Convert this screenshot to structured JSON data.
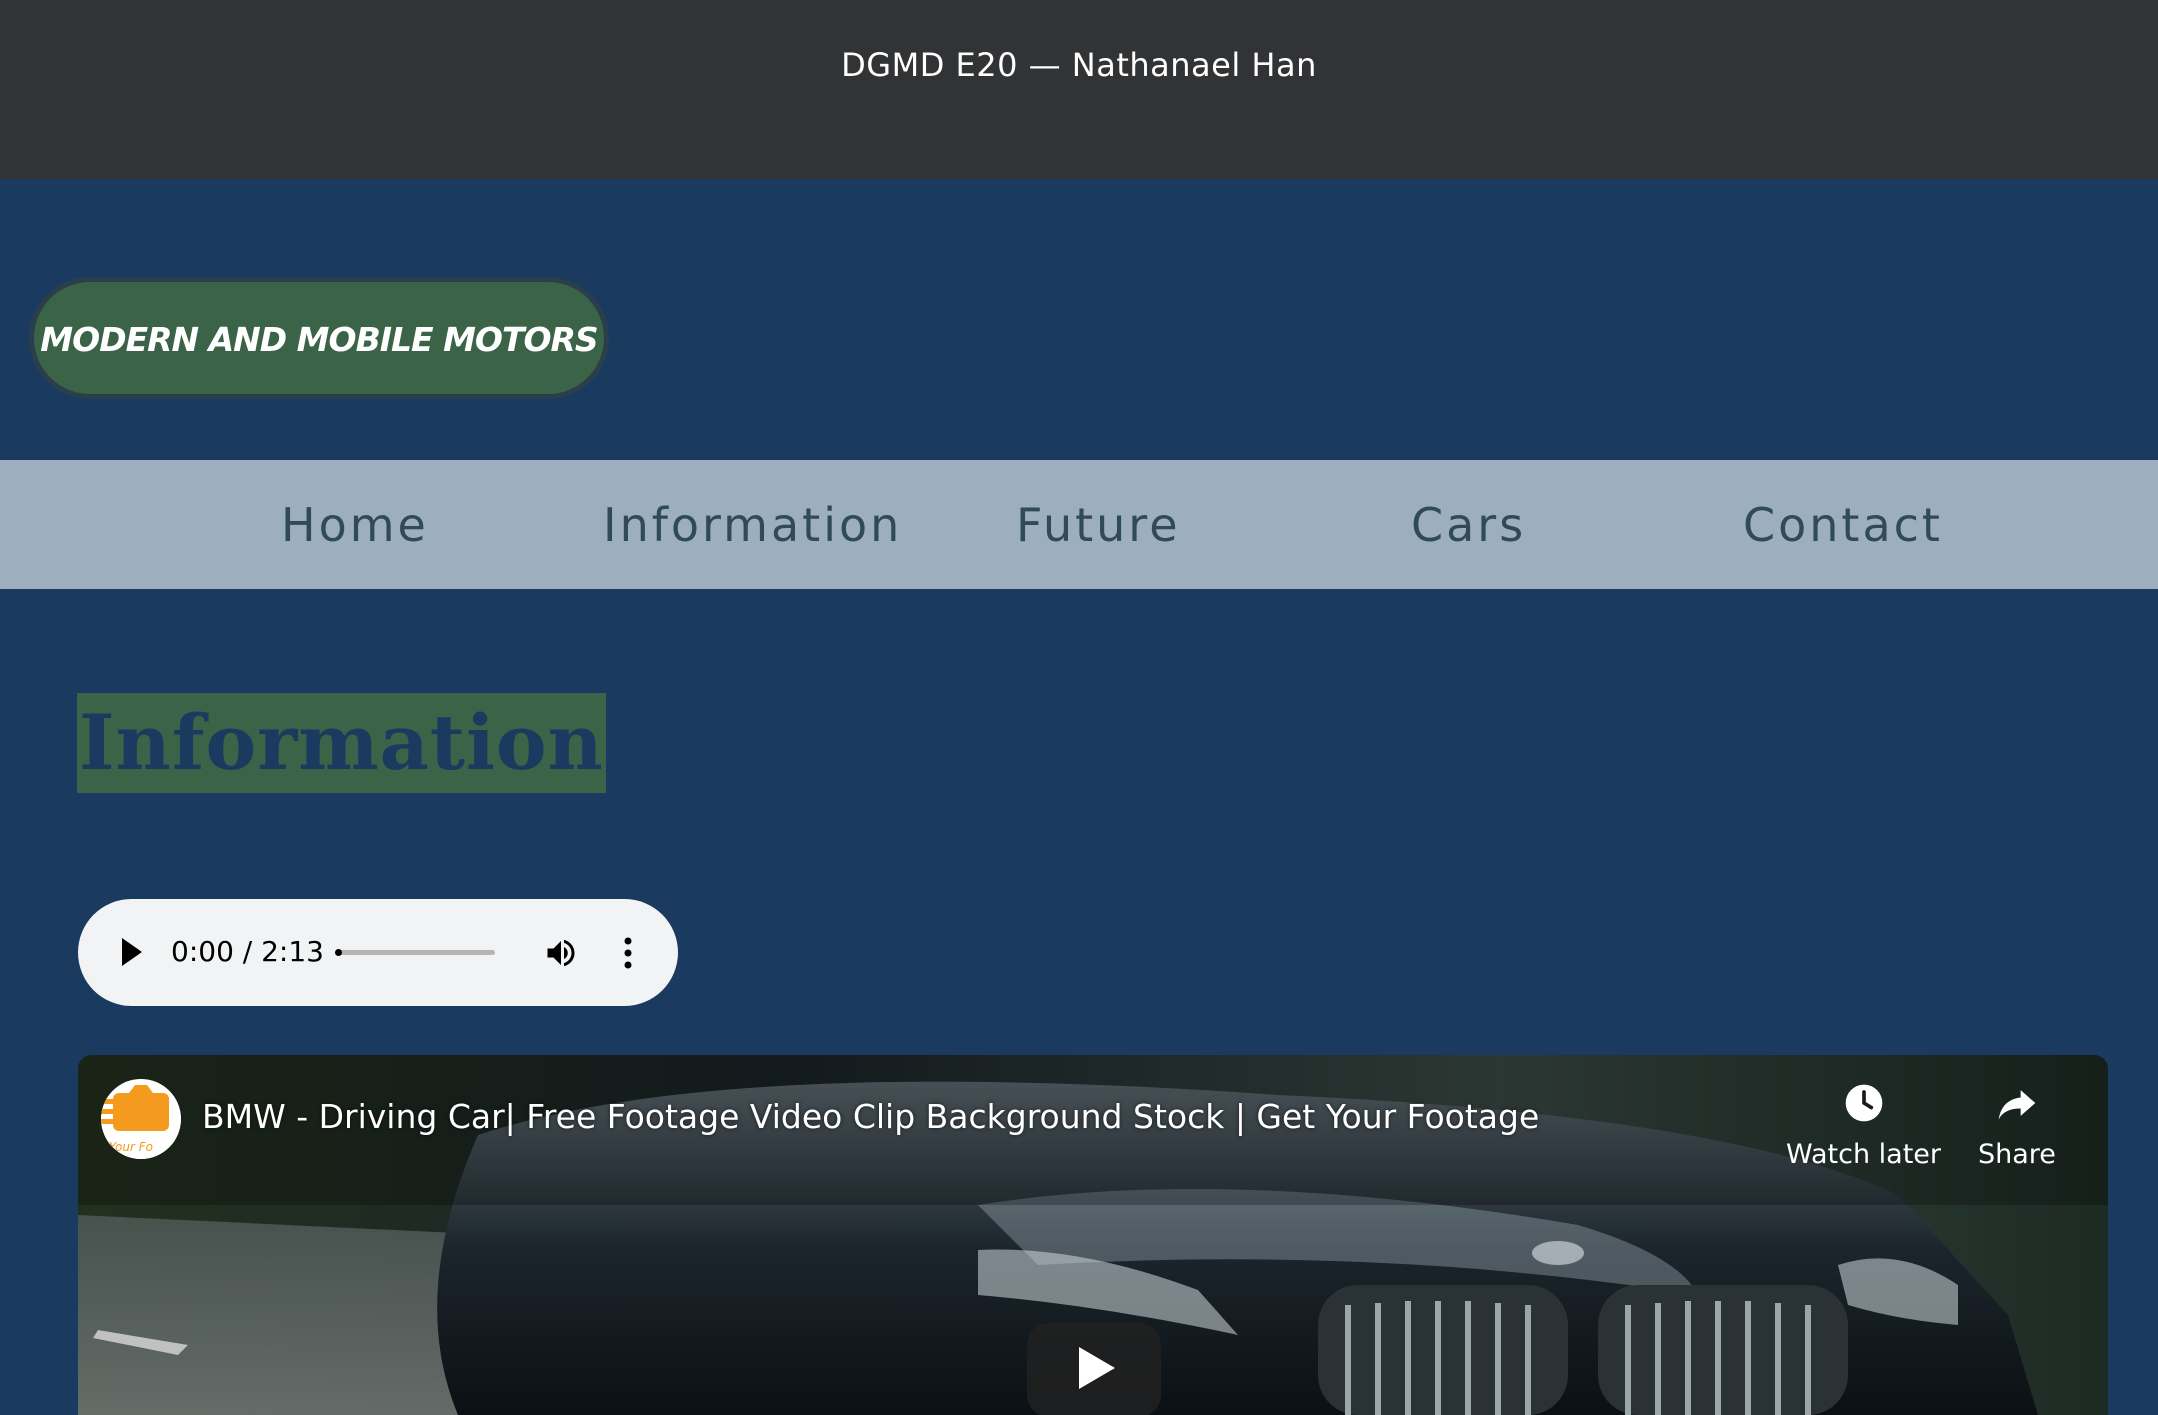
{
  "header": {
    "course_line": "DGMD E20 — Nathanael Han"
  },
  "logo": {
    "text": "Modern and Mobile Motors"
  },
  "nav": {
    "items": [
      {
        "label": "Home"
      },
      {
        "label": "Information"
      },
      {
        "label": "Future"
      },
      {
        "label": "Cars"
      },
      {
        "label": "Contact"
      }
    ]
  },
  "main": {
    "section_title": "Information"
  },
  "audio_player": {
    "time": "0:00 / 2:13",
    "progress": 0
  },
  "video": {
    "title": "BMW - Driving Car| Free Footage Video Clip Background Stock | Get Your Footage",
    "watch_later_label": "Watch later",
    "share_label": "Share",
    "channel_avatar_text": "Your Fo"
  },
  "colors": {
    "topbar": "#323335",
    "page_background": "#1b3a60",
    "logo_green": "#3b6347",
    "nav_background": "#9daebf",
    "nav_text": "#2f4b5a",
    "audio_background": "#f1f3f4"
  }
}
